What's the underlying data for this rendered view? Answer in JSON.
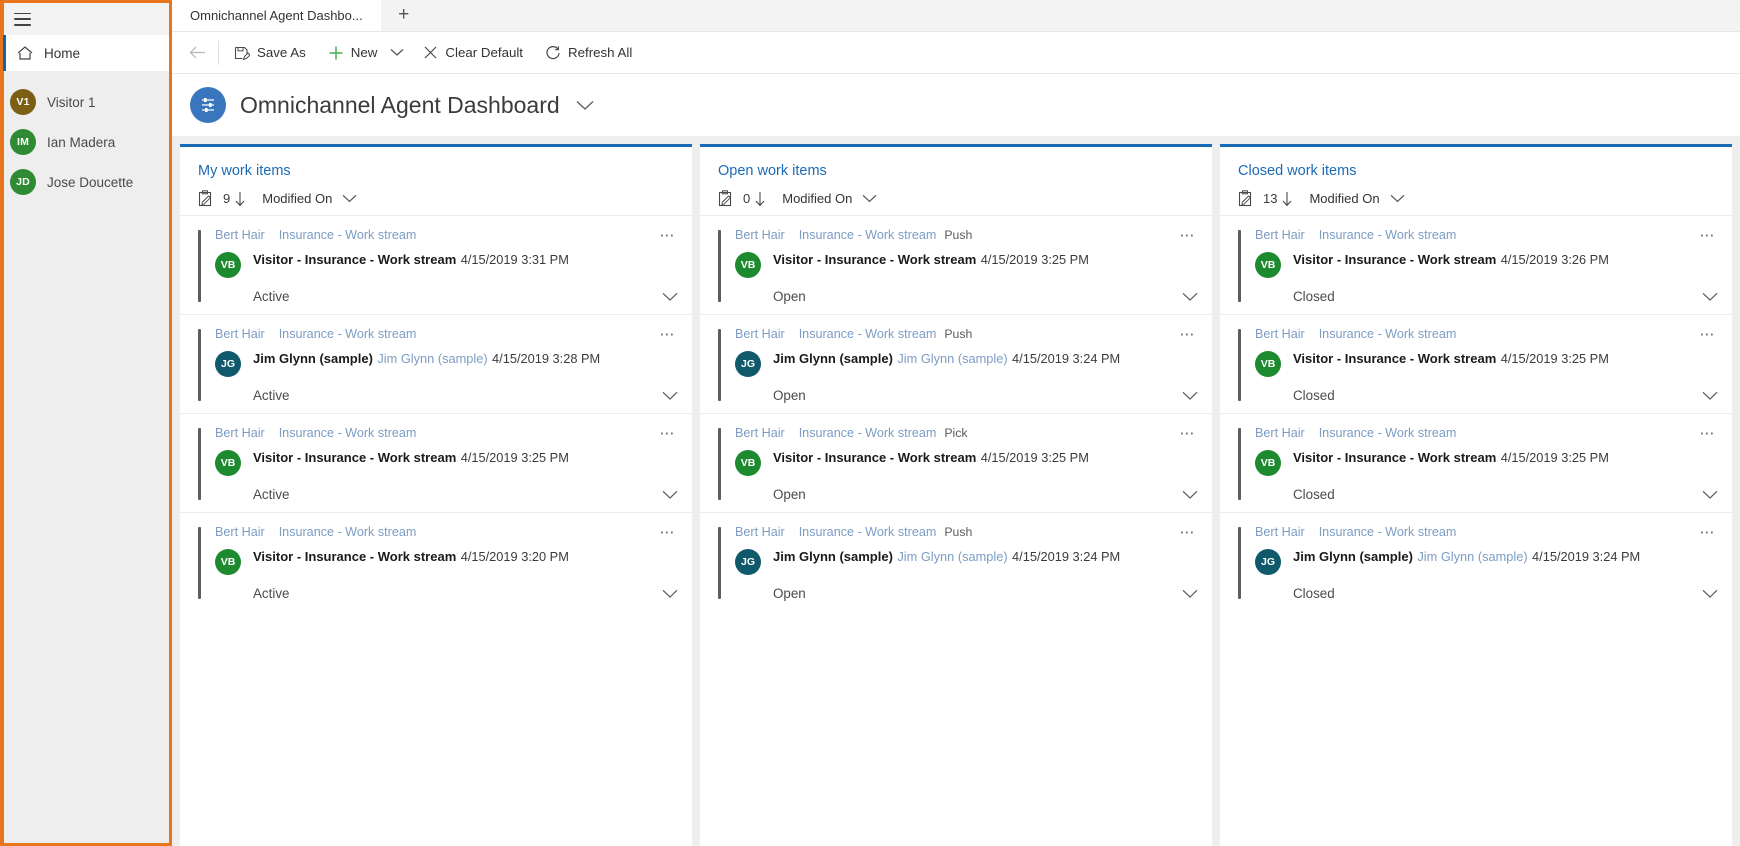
{
  "colors": {
    "accent_orange": "#e8741c",
    "brand_blue": "#1a6bb5",
    "link_blue": "#7c9cc4",
    "avatar_green": "#1e8a2f",
    "avatar_teal": "#10596b",
    "avatar_olive": "#7a5f15"
  },
  "sidebar": {
    "hamburger_icon": "hamburger-icon",
    "home": {
      "label": "Home",
      "icon": "home-icon"
    },
    "people": [
      {
        "initials": "V1",
        "name": "Visitor 1",
        "color": "#7a5f15"
      },
      {
        "initials": "IM",
        "name": "Ian Madera",
        "color": "#2e8b33"
      },
      {
        "initials": "JD",
        "name": "Jose Doucette",
        "color": "#2e8b33"
      }
    ]
  },
  "tabstrip": {
    "tabs": [
      {
        "label": "Omnichannel Agent Dashbo..."
      }
    ],
    "new_tab_label": "+"
  },
  "commandbar": {
    "back_icon": "back-arrow-icon",
    "commands": [
      {
        "label": "Save As",
        "icon": "save-as-icon",
        "caret": false
      },
      {
        "label": "New",
        "icon": "plus-icon",
        "caret": true
      },
      {
        "label": "Clear Default",
        "icon": "close-x-icon",
        "caret": false
      },
      {
        "label": "Refresh All",
        "icon": "refresh-icon",
        "caret": false
      }
    ]
  },
  "page": {
    "icon": "dashboard-icon",
    "title": "Omnichannel Agent Dashboard",
    "title_caret_icon": "chevron-down-icon"
  },
  "streams": [
    {
      "title": "My work items",
      "count": "9",
      "sort_by": "Modified On",
      "cards": [
        {
          "agent": "Bert Hair",
          "workstream": "Insurance - Work stream",
          "mode": "",
          "initials": "VB",
          "avatar_color": "#1e8a2f",
          "primary": "Visitor - Insurance - Work stream",
          "secondary": "",
          "time": "4/15/2019 3:31 PM",
          "status": "Active"
        },
        {
          "agent": "Bert Hair",
          "workstream": "Insurance - Work stream",
          "mode": "",
          "initials": "JG",
          "avatar_color": "#10596b",
          "primary": "Jim Glynn (sample)",
          "secondary": "Jim Glynn (sample)",
          "time": "4/15/2019 3:28 PM",
          "status": "Active"
        },
        {
          "agent": "Bert Hair",
          "workstream": "Insurance - Work stream",
          "mode": "",
          "initials": "VB",
          "avatar_color": "#1e8a2f",
          "primary": "Visitor - Insurance - Work stream",
          "secondary": "",
          "time": "4/15/2019 3:25 PM",
          "status": "Active"
        },
        {
          "agent": "Bert Hair",
          "workstream": "Insurance - Work stream",
          "mode": "",
          "initials": "VB",
          "avatar_color": "#1e8a2f",
          "primary": "Visitor - Insurance - Work stream",
          "secondary": "",
          "time": "4/15/2019 3:20 PM",
          "status": "Active"
        }
      ]
    },
    {
      "title": "Open work items",
      "count": "0",
      "sort_by": "Modified On",
      "cards": [
        {
          "agent": "Bert Hair",
          "workstream": "Insurance - Work stream",
          "mode": "Push",
          "initials": "VB",
          "avatar_color": "#1e8a2f",
          "primary": "Visitor - Insurance - Work stream",
          "secondary": "",
          "time": "4/15/2019 3:25 PM",
          "status": "Open"
        },
        {
          "agent": "Bert Hair",
          "workstream": "Insurance - Work stream",
          "mode": "Push",
          "initials": "JG",
          "avatar_color": "#10596b",
          "primary": "Jim Glynn (sample)",
          "secondary": "Jim Glynn (sample)",
          "time": "4/15/2019 3:24 PM",
          "status": "Open"
        },
        {
          "agent": "Bert Hair",
          "workstream": "Insurance - Work stream",
          "mode": "Pick",
          "initials": "VB",
          "avatar_color": "#1e8a2f",
          "primary": "Visitor - Insurance - Work stream",
          "secondary": "",
          "time": "4/15/2019 3:25 PM",
          "status": "Open"
        },
        {
          "agent": "Bert Hair",
          "workstream": "Insurance - Work stream",
          "mode": "Push",
          "initials": "JG",
          "avatar_color": "#10596b",
          "primary": "Jim Glynn (sample)",
          "secondary": "Jim Glynn (sample)",
          "time": "4/15/2019 3:24 PM",
          "status": "Open"
        }
      ]
    },
    {
      "title": "Closed work items",
      "count": "13",
      "sort_by": "Modified On",
      "cards": [
        {
          "agent": "Bert Hair",
          "workstream": "Insurance - Work stream",
          "mode": "",
          "initials": "VB",
          "avatar_color": "#1e8a2f",
          "primary": "Visitor - Insurance - Work stream",
          "secondary": "",
          "time": "4/15/2019 3:26 PM",
          "status": "Closed"
        },
        {
          "agent": "Bert Hair",
          "workstream": "Insurance - Work stream",
          "mode": "",
          "initials": "VB",
          "avatar_color": "#1e8a2f",
          "primary": "Visitor - Insurance - Work stream",
          "secondary": "",
          "time": "4/15/2019 3:25 PM",
          "status": "Closed"
        },
        {
          "agent": "Bert Hair",
          "workstream": "Insurance - Work stream",
          "mode": "",
          "initials": "VB",
          "avatar_color": "#1e8a2f",
          "primary": "Visitor - Insurance - Work stream",
          "secondary": "",
          "time": "4/15/2019 3:25 PM",
          "status": "Closed"
        },
        {
          "agent": "Bert Hair",
          "workstream": "Insurance - Work stream",
          "mode": "",
          "initials": "JG",
          "avatar_color": "#10596b",
          "primary": "Jim Glynn (sample)",
          "secondary": "Jim Glynn (sample)",
          "time": "4/15/2019 3:24 PM",
          "status": "Closed"
        }
      ]
    }
  ]
}
